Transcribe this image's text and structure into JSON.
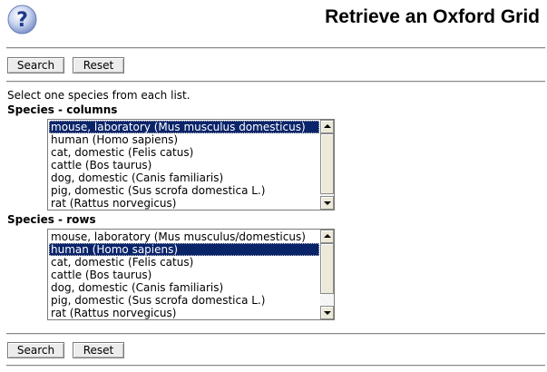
{
  "header": {
    "title": "Retrieve an Oxford Grid",
    "help_icon_glyph": "?"
  },
  "toolbar_top": {
    "search_label": "Search",
    "reset_label": "Reset"
  },
  "form": {
    "instruction": "Select one species from each list.",
    "columns_label": "Species - columns",
    "rows_label": "Species - rows",
    "columns_list": {
      "selected_index": 0,
      "options": [
        "mouse, laboratory (Mus musculus domesticus)",
        "human (Homo sapiens)",
        "cat, domestic (Felis catus)",
        "cattle (Bos taurus)",
        "dog, domestic (Canis familiaris)",
        "pig, domestic (Sus scrofa domestica L.)",
        "rat (Rattus norvegicus)"
      ]
    },
    "rows_list": {
      "selected_index": 1,
      "options": [
        "mouse, laboratory (Mus musculus/domesticus)",
        "human (Homo sapiens)",
        "cat, domestic (Felis catus)",
        "cattle (Bos taurus)",
        "dog, domestic (Canis familiaris)",
        "pig, domestic (Sus scrofa domestica L.)",
        "rat (Rattus norvegicus)"
      ]
    }
  },
  "toolbar_bottom": {
    "search_label": "Search",
    "reset_label": "Reset"
  }
}
